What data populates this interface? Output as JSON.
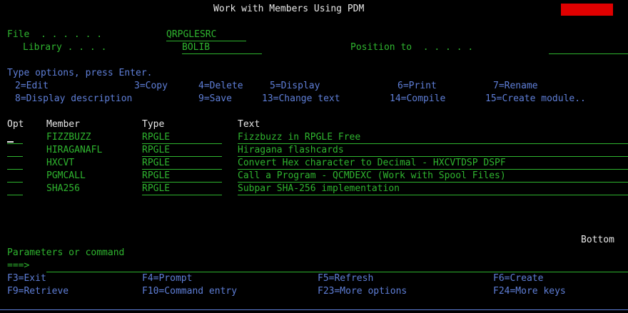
{
  "title": "Work with Members Using PDM",
  "header": {
    "file_label": "File  . . . . . .",
    "file_value": "QRPGLESRC",
    "library_label": "Library . . . .",
    "library_value": "BOLIB",
    "position_label": "Position to  . . . . .",
    "position_value": ""
  },
  "instructions": {
    "line1": "Type options, press Enter.",
    "opt_2": "2=Edit",
    "opt_3": "3=Copy",
    "opt_4": "4=Delete",
    "opt_5": "5=Display",
    "opt_6": "6=Print",
    "opt_7": "7=Rename",
    "opt_8": "8=Display description",
    "opt_9": "9=Save",
    "opt_13": "13=Change text",
    "opt_14": "14=Compile",
    "opt_15": "15=Create module.."
  },
  "columns": {
    "opt": "Opt",
    "member": "Member",
    "type": "Type",
    "text": "Text"
  },
  "rows": [
    {
      "opt": "",
      "member": "FIZZBUZZ",
      "type": "RPGLE",
      "text": "Fizzbuzz in RPGLE Free"
    },
    {
      "opt": "",
      "member": "HIRAGANAFL",
      "type": "RPGLE",
      "text": "Hiragana flashcards"
    },
    {
      "opt": "",
      "member": "HXCVT",
      "type": "RPGLE",
      "text": "Convert Hex character to Decimal - HXCVTDSP DSPF"
    },
    {
      "opt": "",
      "member": "PGMCALL",
      "type": "RPGLE",
      "text": "Call a Program - QCMDEXC (Work with Spool Files)"
    },
    {
      "opt": "",
      "member": "SHA256",
      "type": "RPGLE",
      "text": "Subpar SHA-256 implementation"
    }
  ],
  "bottom_indicator": "Bottom",
  "command": {
    "label": "Parameters or command",
    "prompt": "===>",
    "value": ""
  },
  "fkeys": {
    "f3": "F3=Exit",
    "f4": "F4=Prompt",
    "f5": "F5=Refresh",
    "f6": "F6=Create",
    "f9": "F9=Retrieve",
    "f10": "F10=Command entry",
    "f23": "F23=More options",
    "f24": "F24=More keys"
  },
  "colors": {
    "background": "#000000",
    "green": "#2fb52f",
    "blue": "#5f7fd8",
    "white": "#e8e8e8",
    "alert_red": "#e00000"
  }
}
